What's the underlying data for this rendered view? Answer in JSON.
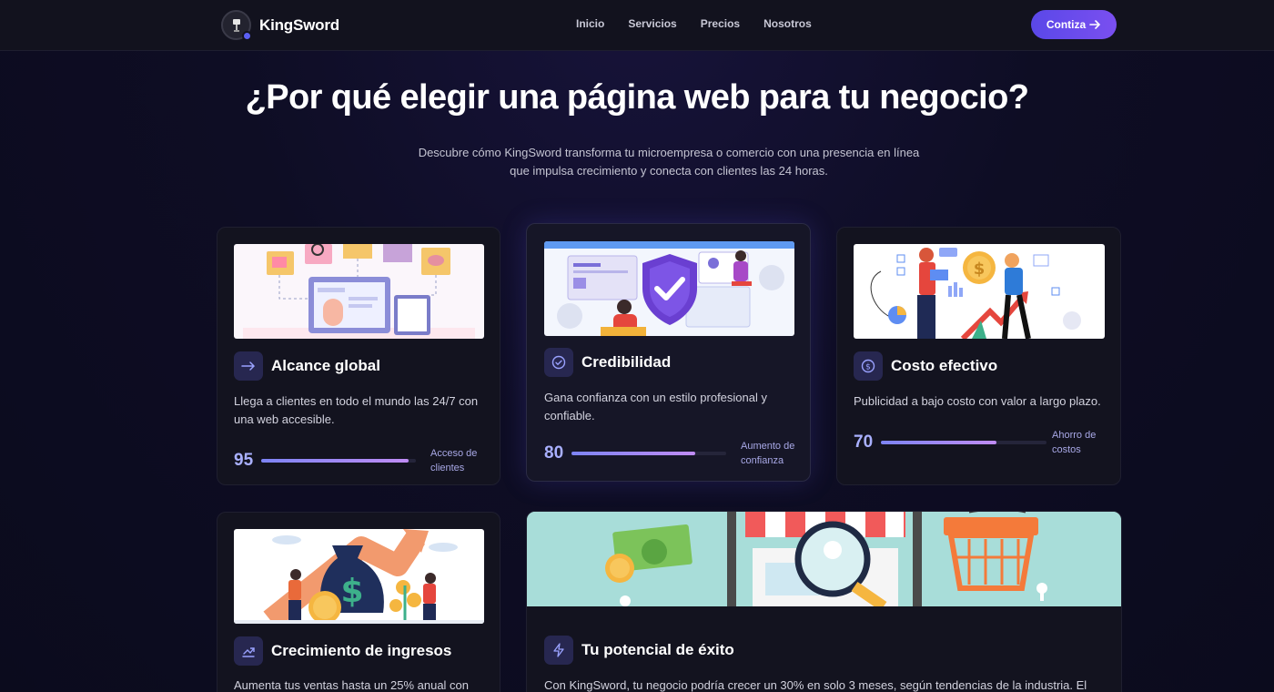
{
  "nav": {
    "brand": "KingSword",
    "links": [
      "Inicio",
      "Servicios",
      "Precios",
      "Nosotros"
    ],
    "cta_label": "Contiza",
    "cta_icon": "arrow-right-icon"
  },
  "hero": {
    "title": "¿Por qué elegir una página web para tu negocio?",
    "subtitle": "Descubre cómo KingSword transforma tu microempresa o comercio con una presencia en línea que impulsa crecimiento y conecta con clientes las 24 horas."
  },
  "cards": [
    {
      "title": "Alcance global",
      "icon": "arrow-right-icon",
      "description": "Llega a clientes en todo el mundo las 24/7 con una web accesible.",
      "stat_value": "95",
      "stat_fraction": 0.95,
      "stat_label": "Acceso de clientes"
    },
    {
      "title": "Credibilidad",
      "icon": "check-circle-icon",
      "description": "Gana confianza con un estilo profesional y confiable.",
      "stat_value": "80",
      "stat_fraction": 0.8,
      "stat_label": "Aumento de confianza"
    },
    {
      "title": "Costo efectivo",
      "icon": "dollar-circle-icon",
      "description": "Publicidad a bajo costo con valor a largo plazo.",
      "stat_value": "70",
      "stat_fraction": 0.7,
      "stat_label": "Ahorro de costos"
    },
    {
      "title": "Crecimiento de ingresos",
      "icon": "chart-growth-icon",
      "description": "Aumenta tus ventas hasta un 25% anual con"
    },
    {
      "title": "Tu potencial de éxito",
      "icon": "lightning-icon",
      "description": "Con KingSword, tu negocio podría crecer un 30% en solo 3 meses, según tendencias de la industria. El"
    }
  ],
  "colors": {
    "accent": "#5b5ff5",
    "cta_start": "#5a48e8",
    "cta_end": "#7a4ff0",
    "stat_number": "#a9b0ff",
    "background": "#0e0d24"
  }
}
